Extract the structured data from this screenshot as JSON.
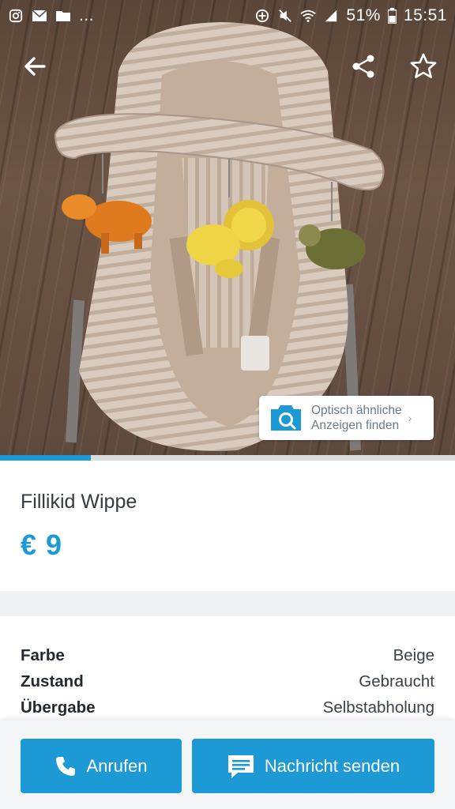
{
  "status_bar": {
    "left_icons": [
      "instagram-icon",
      "mail-icon",
      "folder-icon"
    ],
    "ellipsis": "...",
    "battery": "51%",
    "time": "15:51",
    "right_icons": [
      "data-saver-icon",
      "mute-icon",
      "wifi-icon",
      "signal-icon",
      "battery-icon"
    ]
  },
  "topbar": {
    "back_icon": "arrow-back-icon",
    "share_icon": "share-icon",
    "favorite_icon": "star-outline-icon"
  },
  "visual_search": {
    "line1": "Optisch ähnliche",
    "line2": "Anzeigen finden",
    "icon": "camera-search-icon"
  },
  "gallery": {
    "progress": 0.2
  },
  "listing": {
    "title": "Fillikid Wippe",
    "price": "€ 9"
  },
  "details": [
    {
      "key": "Farbe",
      "value": "Beige"
    },
    {
      "key": "Zustand",
      "value": "Gebraucht"
    },
    {
      "key": "Übergabe",
      "value": "Selbstabholung"
    }
  ],
  "actions": {
    "call_label": "Anrufen",
    "message_label": "Nachricht senden"
  },
  "colors": {
    "accent": "#1d9ad6",
    "text_dark": "#333a40"
  }
}
